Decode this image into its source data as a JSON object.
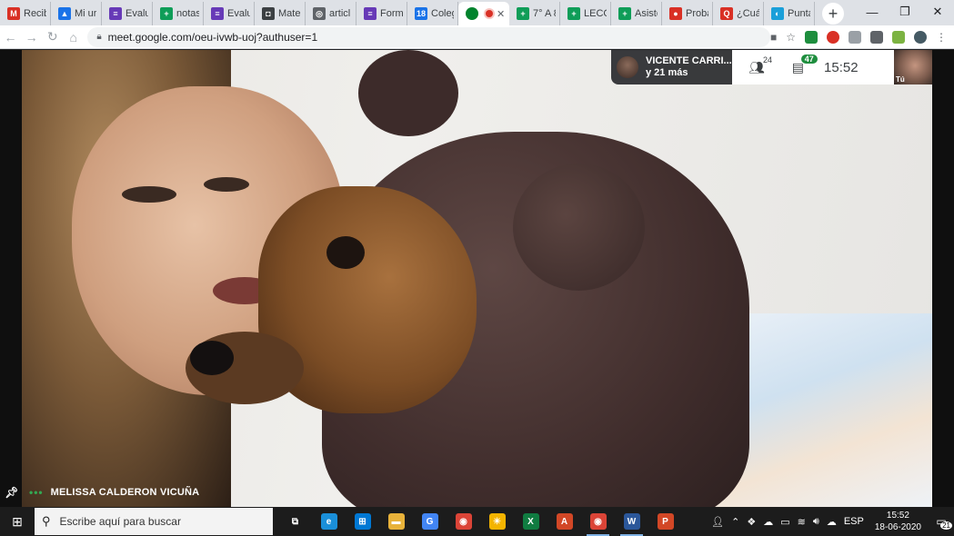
{
  "browser": {
    "tabs": [
      {
        "label": "Recib",
        "icon": "gmail-icon",
        "color": "#d93025",
        "glyph": "M"
      },
      {
        "label": "Mi ur",
        "icon": "drive-icon",
        "color": "#1a73e8",
        "glyph": "▲"
      },
      {
        "label": "Evalu",
        "icon": "forms-icon",
        "color": "#673ab7",
        "glyph": "≡"
      },
      {
        "label": "notas",
        "icon": "sheets-icon",
        "color": "#0f9d58",
        "glyph": "+"
      },
      {
        "label": "Evalu",
        "icon": "forms-icon",
        "color": "#673ab7",
        "glyph": "≡"
      },
      {
        "label": "Mate",
        "icon": "classroom-icon",
        "color": "#3c4043",
        "glyph": "◘"
      },
      {
        "label": "articl",
        "icon": "globe-icon",
        "color": "#5f6368",
        "glyph": "◎"
      },
      {
        "label": "Form",
        "icon": "forms-icon",
        "color": "#673ab7",
        "glyph": "≡"
      },
      {
        "label": "Coleg",
        "icon": "calendar-icon",
        "color": "#1a73e8",
        "glyph": "18"
      }
    ],
    "active_tab": {
      "icon": "meet-icon",
      "color": "#00832d",
      "close_glyph": "✕"
    },
    "tabs_after": [
      {
        "label": "7° A 8",
        "icon": "sheets-icon",
        "color": "#0f9d58",
        "glyph": "+"
      },
      {
        "label": "LECCI",
        "icon": "sheets-icon",
        "color": "#0f9d58",
        "glyph": "+"
      },
      {
        "label": "Asiste",
        "icon": "sheets-icon",
        "color": "#0f9d58",
        "glyph": "+"
      },
      {
        "label": "Proba",
        "icon": "record-icon",
        "color": "#d93025",
        "glyph": "●"
      },
      {
        "label": "¿Cuál",
        "icon": "quizizz-icon",
        "color": "#d93025",
        "glyph": "Q"
      },
      {
        "label": "Punta",
        "icon": "edge-icon",
        "color": "#1a9fd9",
        "glyph": "◐"
      }
    ],
    "new_tab": "+",
    "window_controls": {
      "minimize": "—",
      "restore": "❐",
      "close": "✕"
    },
    "url": "meet.google.com/oeu-ivwb-uoj?authuser=1"
  },
  "meet": {
    "speaker": {
      "name": "VICENTE CARRI...",
      "others": "y 21 más"
    },
    "participants_count": "24",
    "chat_count": "47",
    "time": "15:52",
    "self_label": "Tú",
    "main_speaker_name": "MELISSA CALDERON VICUÑA"
  },
  "taskbar": {
    "search_placeholder": "Escribe aquí para buscar",
    "apps": [
      {
        "name": "task-view-icon",
        "glyph": "⧉",
        "color": "transparent",
        "running": false
      },
      {
        "name": "edge-icon",
        "glyph": "e",
        "color": "#1a8fd9",
        "running": false
      },
      {
        "name": "store-icon",
        "glyph": "⊞",
        "color": "#0078d4",
        "running": false
      },
      {
        "name": "file-explorer-icon",
        "glyph": "▬",
        "color": "#e8b23a",
        "running": false
      },
      {
        "name": "google-icon",
        "glyph": "G",
        "color": "#4285f4",
        "running": false
      },
      {
        "name": "chrome-icon",
        "glyph": "◉",
        "color": "#db4437",
        "running": false
      },
      {
        "name": "weather-icon",
        "glyph": "☀",
        "color": "#f4b400",
        "running": false
      },
      {
        "name": "excel-icon",
        "glyph": "X",
        "color": "#107c41",
        "running": false
      },
      {
        "name": "pdf-icon",
        "glyph": "A",
        "color": "#d24726",
        "running": false
      },
      {
        "name": "chrome-running-icon",
        "glyph": "◉",
        "color": "#db4437",
        "running": true
      },
      {
        "name": "word-icon",
        "glyph": "W",
        "color": "#2b579a",
        "running": true
      },
      {
        "name": "powerpoint-icon",
        "glyph": "P",
        "color": "#d24726",
        "running": false
      }
    ],
    "tray": {
      "language": "ESP",
      "time": "15:52",
      "date": "18-06-2020",
      "notifications": "21"
    }
  }
}
